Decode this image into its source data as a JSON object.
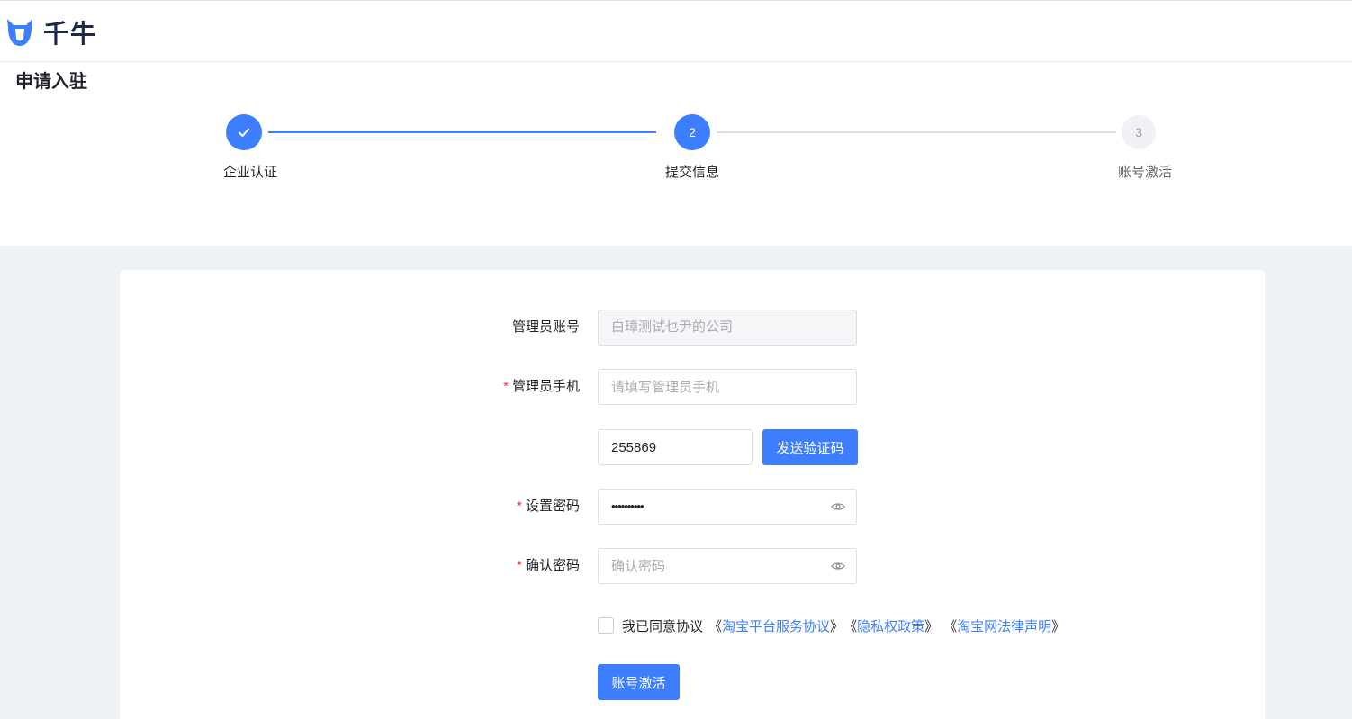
{
  "header": {
    "logo_text": "千牛"
  },
  "page": {
    "title": "申请入驻"
  },
  "steps": [
    {
      "label": "企业认证",
      "number": "1",
      "status": "done"
    },
    {
      "label": "提交信息",
      "number": "2",
      "status": "active"
    },
    {
      "label": "账号激活",
      "number": "3",
      "status": "pending"
    }
  ],
  "form": {
    "admin_account": {
      "label": "管理员账号",
      "value": "白璋测试乜尹的公司",
      "required": false
    },
    "admin_phone": {
      "label": "管理员手机",
      "placeholder": "请填写管理员手机",
      "required": true
    },
    "verify_code": {
      "value": "255869",
      "send_button": "发送验证码"
    },
    "password": {
      "label": "设置密码",
      "value": "••••••••••",
      "required": true
    },
    "confirm_password": {
      "label": "确认密码",
      "placeholder": "确认密码",
      "required": true
    },
    "agreement": {
      "prefix": "我已同意协议",
      "links": [
        "淘宝平台服务协议",
        "隐私权政策",
        "淘宝网法律声明"
      ],
      "open_bracket": "《",
      "close_bracket": "》"
    },
    "submit_button": "账号激活",
    "required_mark": "*"
  },
  "colors": {
    "primary": "#3d7eff",
    "required": "#f5313c",
    "background": "#eef1f5"
  },
  "icons": {
    "logo": "qianniu-bull-icon",
    "step_done": "check-icon",
    "password_toggle": "eye-icon"
  }
}
